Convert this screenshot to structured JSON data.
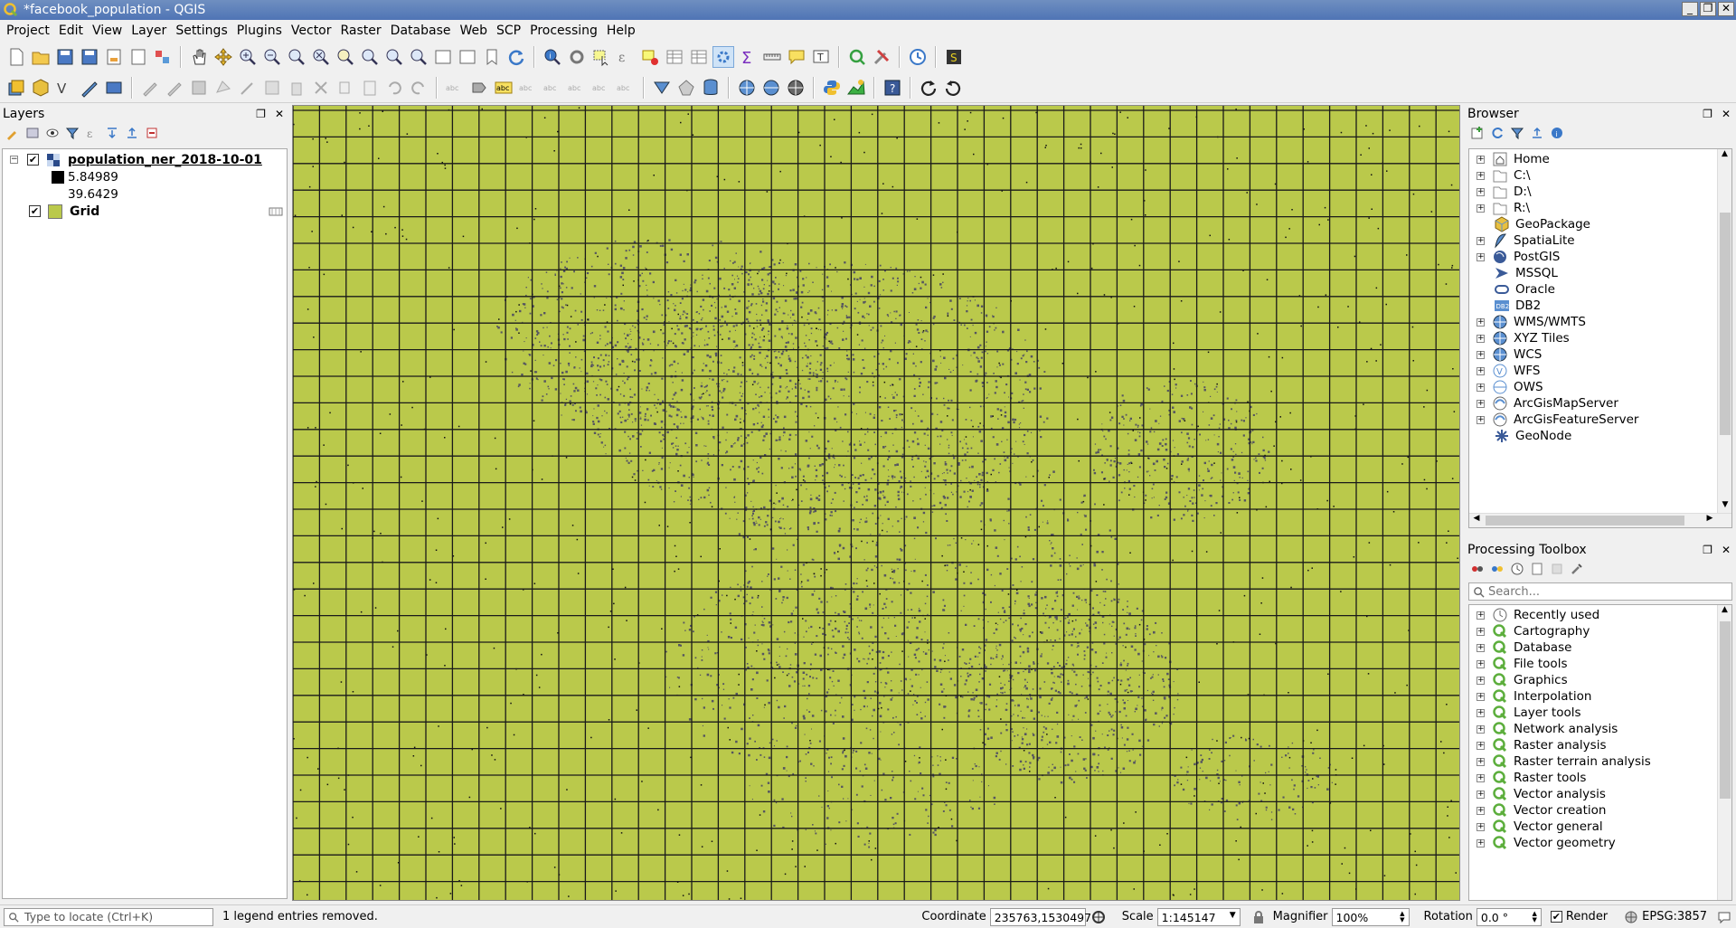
{
  "window": {
    "title": "*facebook_population - QGIS"
  },
  "menus": [
    "Project",
    "Edit",
    "View",
    "Layer",
    "Settings",
    "Plugins",
    "Vector",
    "Raster",
    "Database",
    "Web",
    "SCP",
    "Processing",
    "Help"
  ],
  "layers_panel": {
    "title": "Layers",
    "layers": [
      {
        "name": "population_ner_2018-10-01",
        "checked": true,
        "legend": [
          "5.84989",
          "39.6429"
        ]
      },
      {
        "name": "Grid",
        "checked": true,
        "color": "#bac94b"
      }
    ]
  },
  "browser_panel": {
    "title": "Browser",
    "items": [
      "Home",
      "C:\\",
      "D:\\",
      "R:\\",
      "GeoPackage",
      "SpatiaLite",
      "PostGIS",
      "MSSQL",
      "Oracle",
      "DB2",
      "WMS/WMTS",
      "XYZ Tiles",
      "WCS",
      "WFS",
      "OWS",
      "ArcGisMapServer",
      "ArcGisFeatureServer",
      "GeoNode"
    ]
  },
  "processing_panel": {
    "title": "Processing Toolbox",
    "search_placeholder": "Search...",
    "items": [
      "Recently used",
      "Cartography",
      "Database",
      "File tools",
      "Graphics",
      "Interpolation",
      "Layer tools",
      "Network analysis",
      "Raster analysis",
      "Raster terrain analysis",
      "Raster tools",
      "Vector analysis",
      "Vector creation",
      "Vector general",
      "Vector geometry"
    ]
  },
  "statusbar": {
    "locate_placeholder": "Type to locate (Ctrl+K)",
    "message": "1 legend entries removed.",
    "coordinate_label": "Coordinate",
    "coordinate_value": "235763,1530497",
    "scale_label": "Scale",
    "scale_value": "1:145147",
    "magnifier_label": "Magnifier",
    "magnifier_value": "100%",
    "rotation_label": "Rotation",
    "rotation_value": "0.0 °",
    "render_label": "Render",
    "crs": "EPSG:3857"
  },
  "colors": {
    "map_fill": "#bac94b",
    "grid_line": "#1a1a1a",
    "population": "#555560"
  }
}
